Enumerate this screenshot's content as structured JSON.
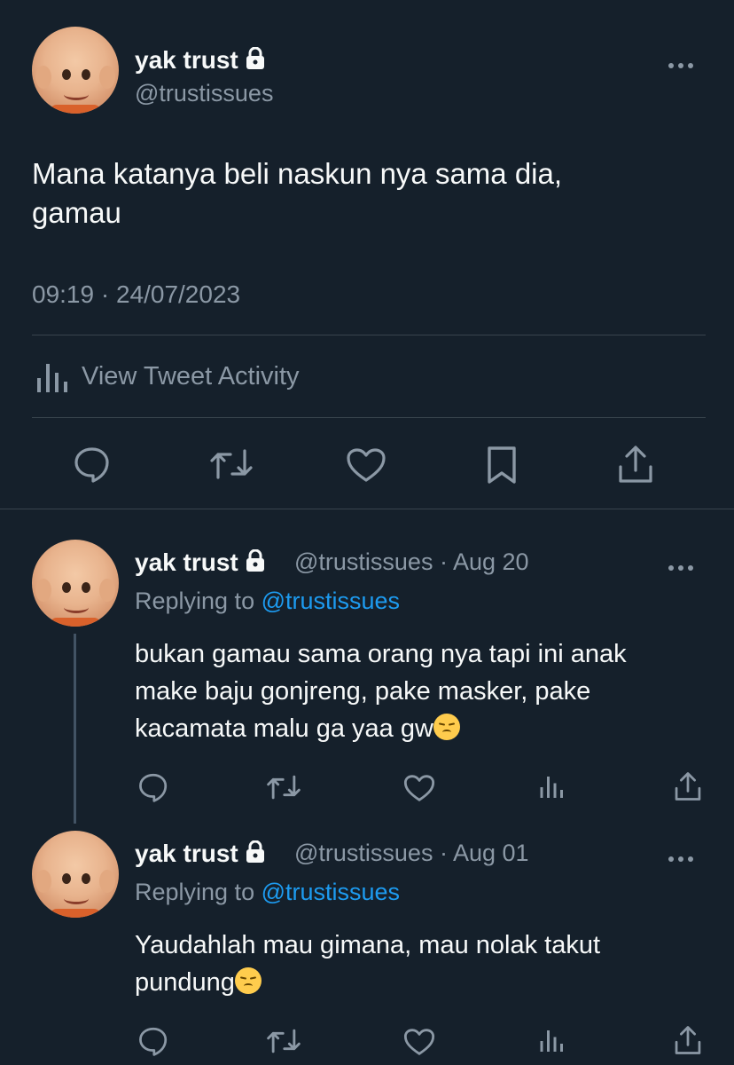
{
  "main_tweet": {
    "display_name": "yak trust",
    "handle": "@trustissues",
    "text_line1": "Mana katanya beli naskun nya sama dia,",
    "text_line2": "gamau",
    "timestamp": "09:19 · 24/07/2023",
    "activity_label": "View Tweet Activity"
  },
  "replies": [
    {
      "display_name": "yak trust",
      "handle_date": "@trustissues · Aug 20",
      "replying_prefix": "Replying to",
      "replying_to": "@trustissues",
      "line1": "bukan gamau sama orang nya tapi ini anak",
      "line2": "make baju gonjreng, pake masker, pake",
      "line3": "kacamata malu ga yaa gw",
      "emoji": "pensive-face"
    },
    {
      "display_name": "yak trust",
      "handle_date": "@trustissues · Aug 01",
      "replying_prefix": "Replying to",
      "replying_to": "@trustissues",
      "line1": "Yaudahlah mau gimana, mau nolak takut",
      "line2": "pundung",
      "emoji": "pensive-face"
    }
  ],
  "colors": {
    "background": "#15202b",
    "text": "#f7f9f9",
    "muted": "#8b98a5",
    "link": "#1d9bf0",
    "divider": "#38444d"
  }
}
